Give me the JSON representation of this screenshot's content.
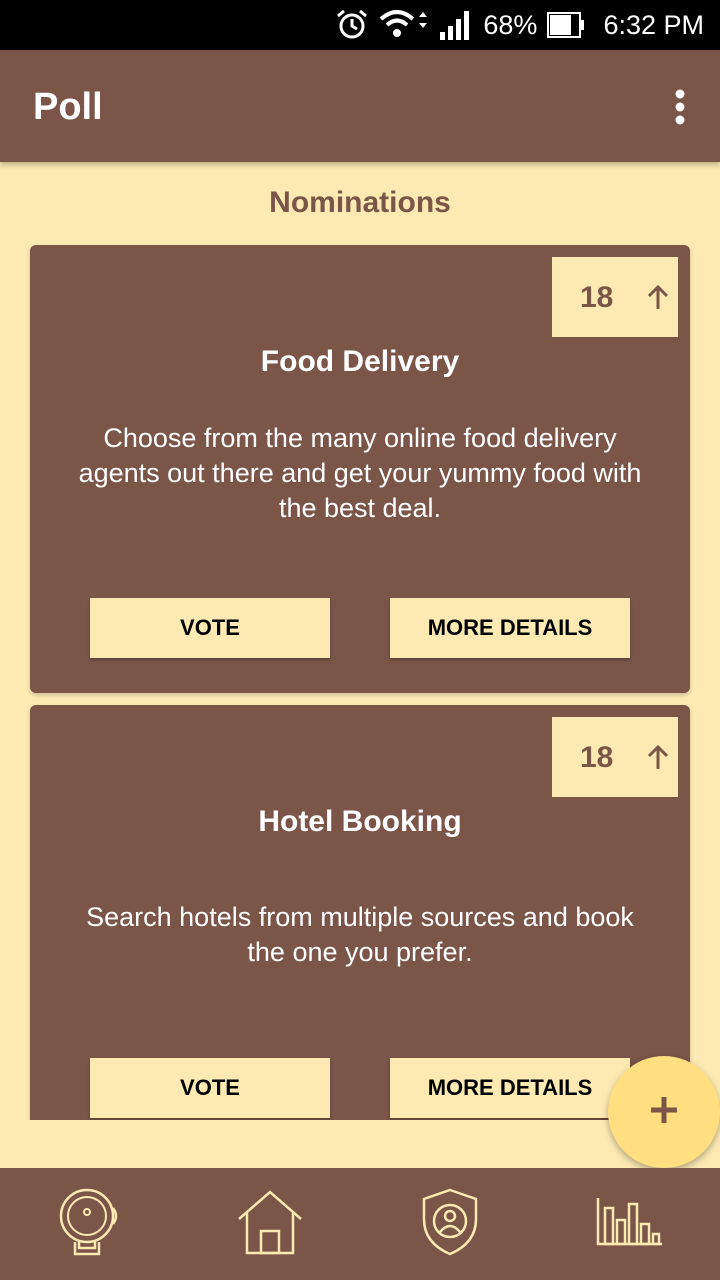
{
  "status_bar": {
    "battery": "68%",
    "time": "6:32 PM",
    "icons": [
      "alarm-icon",
      "wifi-icon",
      "signal-icon",
      "battery-icon"
    ]
  },
  "app_bar": {
    "title": "Poll",
    "menu_icon": "more-vertical-icon"
  },
  "section_title": "Nominations",
  "nominations": [
    {
      "title": "Food Delivery",
      "description": "Choose from the many online food delivery agents out there and get your yummy food with the best deal.",
      "votes": "18",
      "vote_label": "VOTE",
      "details_label": "MORE DETAILS"
    },
    {
      "title": "Hotel Booking",
      "description": "Search hotels from multiple sources and book the one you prefer.",
      "votes": "18",
      "vote_label": "VOTE",
      "details_label": "MORE DETAILS"
    }
  ],
  "fab_icon": "plus-icon",
  "bottom_nav": [
    "bell-icon",
    "home-icon",
    "shield-user-icon",
    "bar-chart-icon"
  ],
  "colors": {
    "primary": "#7a5548",
    "background": "#fdeab3",
    "accent": "#ffdf80"
  }
}
